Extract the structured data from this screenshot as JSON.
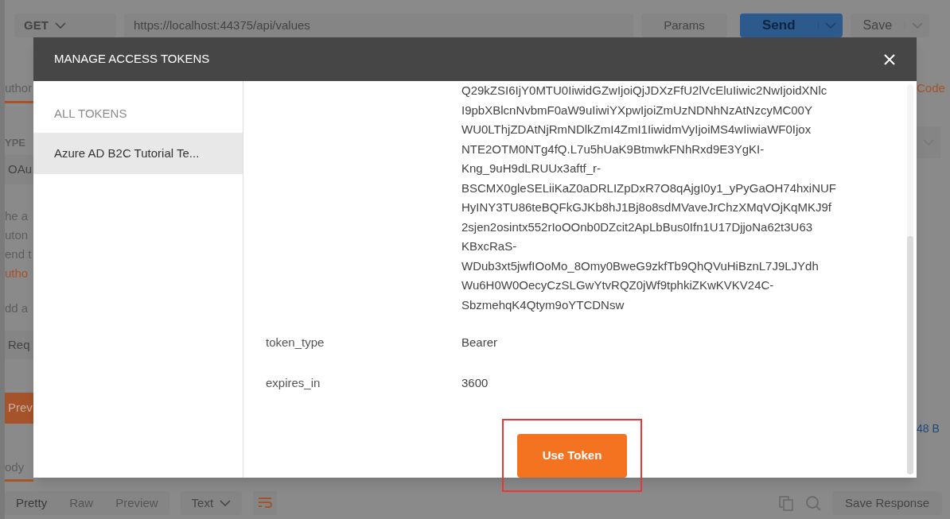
{
  "background": {
    "request_bar": {
      "method": "GET",
      "url": "https://localhost:44375/api/values",
      "params_label": "Params",
      "send_label": "Send",
      "save_label": "Save"
    },
    "left_fragments": [
      {
        "text": "uthor",
        "kind": "tab"
      },
      {
        "text": "YPE",
        "kind": "label"
      },
      {
        "text": "OAu",
        "kind": "field"
      },
      {
        "text": "he a",
        "kind": "text"
      },
      {
        "text": "uton",
        "kind": "text"
      },
      {
        "text": "end t",
        "kind": "text"
      },
      {
        "text": "utho",
        "kind": "link"
      },
      {
        "text": "dd a",
        "kind": "text"
      },
      {
        "text": "Req",
        "kind": "field"
      },
      {
        "text": "Prev",
        "kind": "button"
      },
      {
        "text": "ody",
        "kind": "tab"
      }
    ],
    "code_link": "Code",
    "response_size": "48 B",
    "response_toolbar": {
      "view_tabs": [
        {
          "label": "Pretty",
          "selected": true
        },
        {
          "label": "Raw",
          "selected": false
        },
        {
          "label": "Preview",
          "selected": false
        }
      ],
      "format": "Text",
      "save_response": "Save Response"
    }
  },
  "modal": {
    "title": "MANAGE ACCESS TOKENS",
    "sidebar": {
      "heading": "ALL TOKENS",
      "items": [
        {
          "label": "Azure AD B2C Tutorial Te...",
          "selected": true
        }
      ]
    },
    "token_value_lines": [
      "Q29kZSI6IjY0MTU0IiwidGZwIjoiQjJDXzFfU2lVcEluIiwic2NwIjoidXNlc",
      "I9pbXBlcnNvbmF0aW9uIiwiYXpwIjoiZmUzNDNhNzAtNzcyMC00Y",
      "WU0LThjZDAtNjRmNDlkZmI4ZmI1IiwidmVyIjoiMS4wIiwiaWF0Ijox",
      "NTE2OTM0NTg4fQ.L7u5hUaK9BtmwkFNhRxd9E3YgKI-",
      "Kng_9uH9dLRUUx3aftf_r-",
      "BSCMX0gleSELiiKaZ0aDRLIZpDxR7O8qAjgI0y1_yPyGaOH74hxiNUF",
      "HyINY3TU86teBQFkGJKb8hJ1Bj8o8sdMVaveJrChzXMqVOjKqMKJ9f",
      "2sjen2osintx552rIoOOnb0DZcit2ApLbBus0Ifn1U17DjjoNa62t3U63",
      "KBxcRaS-",
      "WDub3xt5jwfIOoMo_8Omy0BweG9zkfTb9QhQVuHiBznL7J9LJYdh",
      "Wu6H0W0OecyCzSLGwYtvRQZ0jWf9tphkiZKwKVKV24C-",
      "SbzmehqK4Qtym9oYTCDNsw"
    ],
    "fields": [
      {
        "key": "token_type",
        "value": "Bearer"
      },
      {
        "key": "expires_in",
        "value": "3600"
      }
    ],
    "action_button": {
      "label": "Use Token",
      "highlighted": true
    }
  }
}
